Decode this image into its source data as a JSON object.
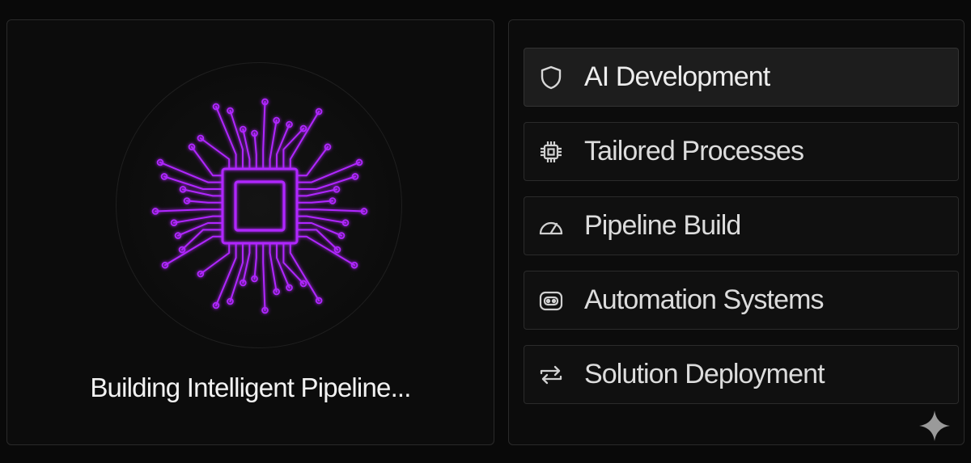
{
  "status": {
    "text": "Building Intelligent Pipeline..."
  },
  "graphic": {
    "icon": "chip-circuit-icon",
    "glow_color": "#b026ff"
  },
  "menu": {
    "items": [
      {
        "label": "AI Development",
        "icon": "shield-icon",
        "active": true
      },
      {
        "label": "Tailored Processes",
        "icon": "cpu-icon",
        "active": false
      },
      {
        "label": "Pipeline Build",
        "icon": "gauge-icon",
        "active": false
      },
      {
        "label": "Automation Systems",
        "icon": "bot-icon",
        "active": false
      },
      {
        "label": "Solution Deployment",
        "icon": "refresh-icon",
        "active": false
      }
    ]
  },
  "corner_icon": "sparkle-icon"
}
